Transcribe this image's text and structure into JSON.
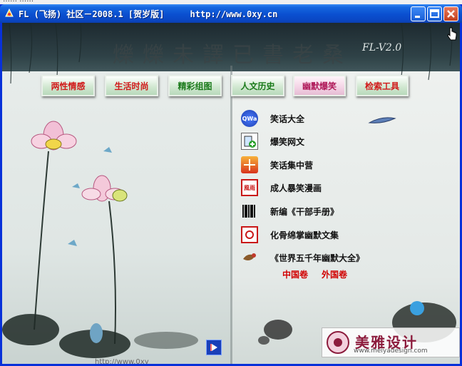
{
  "window": {
    "title": "FL (飞扬) 社区－2008.1 [贺岁版]     http://www.0xy.cn",
    "strip_text": "…… ……"
  },
  "header": {
    "calligraphy": "爍爍未譯已書老桑",
    "version": "FL-V2.0"
  },
  "nav": [
    {
      "label": "两性情感"
    },
    {
      "label": "生活时尚"
    },
    {
      "label": "精彩组图"
    },
    {
      "label": "人文历史"
    },
    {
      "label": "幽默爆笑"
    },
    {
      "label": "检索工具"
    }
  ],
  "menu": [
    {
      "label": "笑话大全",
      "icon": "qwa-badge-icon",
      "icon_text": "QWa"
    },
    {
      "label": "爆笑网文",
      "icon": "book-add-icon",
      "icon_text": ""
    },
    {
      "label": "笑话集中营",
      "icon": "gift-box-icon",
      "icon_text": ""
    },
    {
      "label": "成人暴笑漫画",
      "icon": "seal-stamp-icon",
      "icon_text": "風雨"
    },
    {
      "label": "新编《干部手册》",
      "icon": "barcode-icon",
      "icon_text": ""
    },
    {
      "label": "化骨绵掌幽默文集",
      "icon": "scroll-stamp-icon",
      "icon_text": ""
    },
    {
      "label": "《世界五千年幽默大全》",
      "icon": "bird-icon",
      "icon_text": ""
    }
  ],
  "sub_links": [
    "中国卷",
    "外国卷"
  ],
  "watermark": {
    "text": "美雅设计",
    "url": "www.meiyadesign.com"
  },
  "bottom_url": "http://www.0xy",
  "colors": {
    "title_bar": "#0a4fd0",
    "nav_text_red": "#d11a1a",
    "link_red": "#d10000"
  }
}
